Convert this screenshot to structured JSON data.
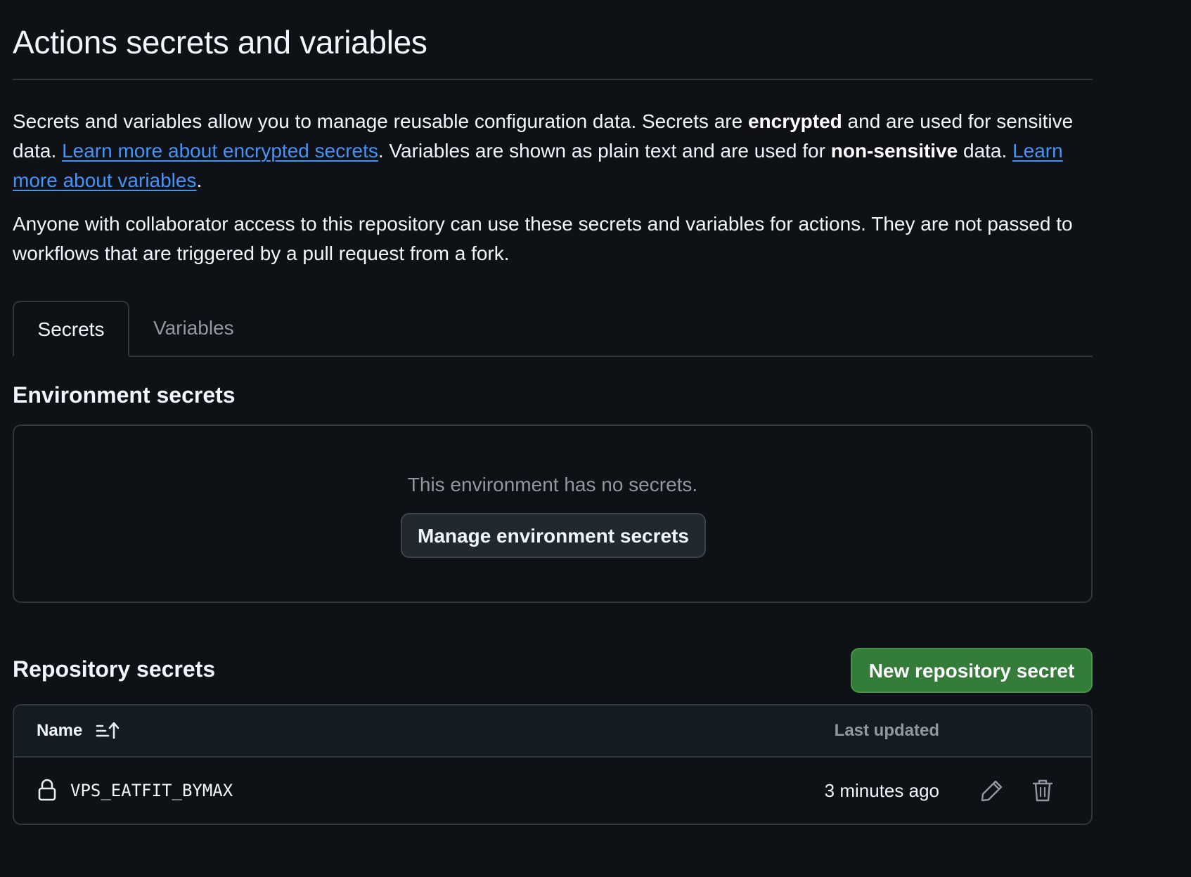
{
  "header": {
    "title": "Actions secrets and variables"
  },
  "intro": {
    "text1": "Secrets and variables allow you to manage reusable configuration data. Secrets are ",
    "bold1": "encrypted",
    "text2": " and are used for sensitive data. ",
    "link1": "Learn more about encrypted secrets",
    "text3": ". Variables are shown as plain text and are used for ",
    "bold2": "non-sensitive",
    "text4": " data. ",
    "link2": "Learn more about variables",
    "text5": "."
  },
  "note": "Anyone with collaborator access to this repository can use these secrets and variables for actions. They are not passed to workflows that are triggered by a pull request from a fork.",
  "tabs": [
    {
      "label": "Secrets",
      "active": true
    },
    {
      "label": "Variables",
      "active": false
    }
  ],
  "environment": {
    "heading": "Environment secrets",
    "empty_text": "This environment has no secrets.",
    "manage_button": "Manage environment secrets"
  },
  "repository": {
    "heading": "Repository secrets",
    "new_button": "New repository secret",
    "columns": {
      "name": "Name",
      "updated": "Last updated"
    },
    "rows": [
      {
        "name": "VPS_EATFIT_BYMAX",
        "updated": "3 minutes ago"
      }
    ]
  },
  "icons": {
    "sort": "sort-ascending-icon",
    "lock": "lock-icon",
    "edit": "pencil-icon",
    "delete": "trash-icon"
  },
  "colors": {
    "background": "#0e1116",
    "link": "#4493f8",
    "primary_button": "#347d39",
    "border": "#30363d",
    "muted_text": "#9198a1"
  }
}
